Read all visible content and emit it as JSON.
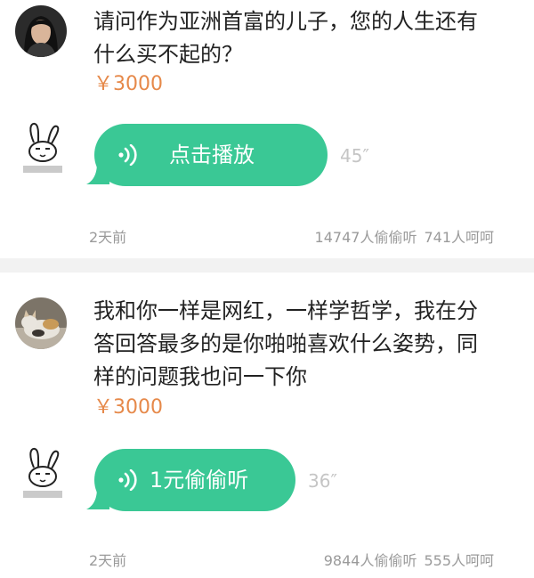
{
  "feed": [
    {
      "question": "请问作为亚洲首富的儿子，您的人生还有\n什么买不起的？",
      "price": "￥3000",
      "play_label": "点击播放",
      "duration": "45″",
      "time": "2天前",
      "listen_count": "14747人偷偷听",
      "like_count": "741人呵呵",
      "bubble_color": "#3ac895"
    },
    {
      "question": "我和你一样是网红，一样学哲学，我在分\n答回答最多的是你啪啪喜欢什么姿势，同\n样的问题我也问一下你",
      "price": "￥3000",
      "play_label": "1元偷偷听",
      "duration": "36″",
      "time": "2天前",
      "listen_count": "9844人偷偷听",
      "like_count": "555人呵呵",
      "bubble_color": "#3ac895"
    }
  ],
  "icons": {
    "asker_1": "asker-avatar-woman",
    "asker_2": "asker-avatar-cat",
    "answerer": "rabbit-sticker-icon",
    "voice": "sound-wave-icon"
  },
  "colors": {
    "price": "#e6894a",
    "meta": "#9a9a9a",
    "duration": "#c5c5c5",
    "divider": "#f2f2f2"
  }
}
